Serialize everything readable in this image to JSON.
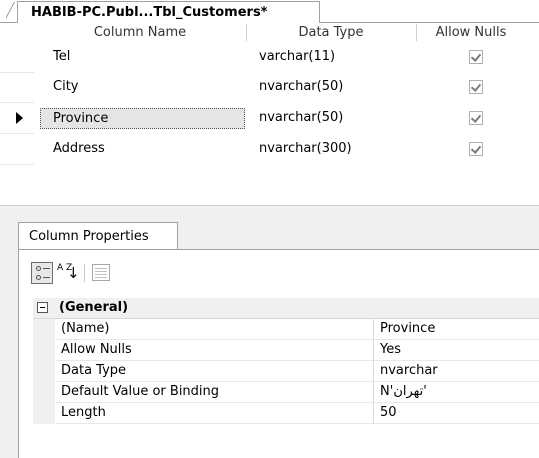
{
  "document_tab": {
    "title": "HABIB-PC.Publ...Tbl_Customers*"
  },
  "columns_grid": {
    "headers": [
      "Column Name",
      "Data Type",
      "Allow Nulls"
    ],
    "rows": [
      {
        "name": "Tel",
        "type": "varchar(11)",
        "allow_nulls": true
      },
      {
        "name": "City",
        "type": "nvarchar(50)",
        "allow_nulls": true
      },
      {
        "name": "Province",
        "type": "nvarchar(50)",
        "allow_nulls": true
      },
      {
        "name": "Address",
        "type": "nvarchar(300)",
        "allow_nulls": true
      }
    ],
    "current_row": "Province"
  },
  "column_properties": {
    "tab_label": "Column Properties",
    "toolbar": {
      "categorized_icon": "categorized-icon",
      "alphabetical_icon": "sort-alphabetical-icon",
      "property_pages_icon": "property-pages-icon",
      "alphabetical_text": "A Z"
    },
    "group": {
      "label": "(General)",
      "expanded_symbol": "minus"
    },
    "properties": [
      {
        "label": "(Name)",
        "value": "Province"
      },
      {
        "label": "Allow Nulls",
        "value": "Yes"
      },
      {
        "label": "Data Type",
        "value": "nvarchar"
      },
      {
        "label": "Default Value or Binding",
        "value": "N'تهران'"
      },
      {
        "label": "Length",
        "value": "50"
      }
    ]
  }
}
